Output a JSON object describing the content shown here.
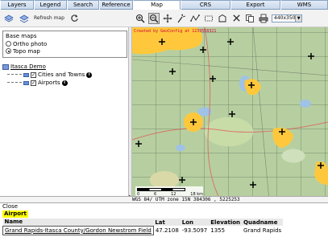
{
  "tabs": [
    {
      "label": "Layers",
      "active": false
    },
    {
      "label": "Legend",
      "active": false
    },
    {
      "label": "Search",
      "active": false
    },
    {
      "label": "Reference",
      "active": false
    },
    {
      "label": "Map",
      "active": true
    },
    {
      "label": "CRS",
      "active": false
    },
    {
      "label": "Export",
      "active": false
    },
    {
      "label": "WMS",
      "active": false
    }
  ],
  "left_toolbar": {
    "refresh_label": "Refresh map"
  },
  "basemaps": {
    "title": "Base maps",
    "options": [
      {
        "label": "Ortho photo",
        "selected": false
      },
      {
        "label": "Topo map",
        "selected": true
      }
    ]
  },
  "layer_tree": {
    "root": "Itasca Demo",
    "items": [
      {
        "label": "Cities and Towns",
        "checked": true
      },
      {
        "label": "Airports",
        "checked": true
      }
    ]
  },
  "map": {
    "credit": "Created by GeoConfig at 1239558321",
    "size_option": "440x350",
    "scale_ticks": [
      "0",
      "6",
      "12",
      "18 km"
    ],
    "coordinates": "WGS 84/ UTM zone 15N  384306 , 5225253"
  },
  "results": {
    "close_label": "Close",
    "layer_name": "Airport",
    "columns": [
      "Name",
      "Lat",
      "Lon",
      "Elevation",
      "Quadname"
    ],
    "rows": [
      {
        "name": "Grand Rapids-Itasca County/Gordon Newstrom Field",
        "lat": "47.2108",
        "lon": "-93.5097",
        "elevation": "1355",
        "quadname": "Grand Rapids"
      }
    ]
  },
  "colors": {
    "airport_area": "#ffc83c",
    "credit_text": "#d0003a",
    "highlight": "#ffff00"
  }
}
